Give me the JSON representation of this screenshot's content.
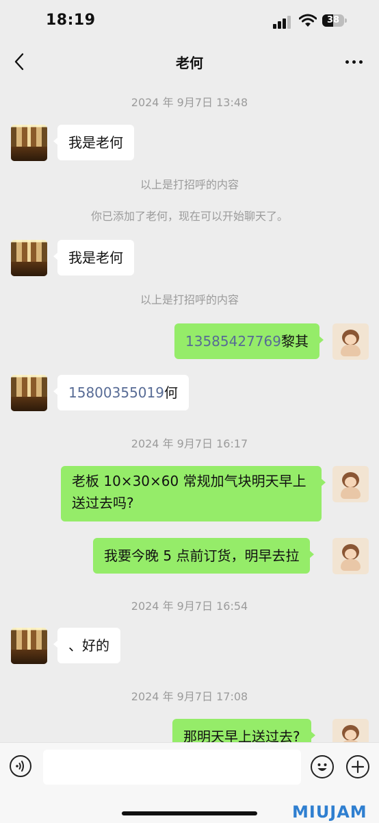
{
  "status": {
    "time": "18:19",
    "battery": "38",
    "icons": [
      "cellular-signal-icon",
      "wifi-icon",
      "battery-icon"
    ]
  },
  "nav": {
    "back_icon": "chevron-left-icon",
    "title": "老何",
    "more_icon": "more-horizontal-icon"
  },
  "messages": {
    "t1": "2024 年 9月7日 13:48",
    "m1": "我是老何",
    "sys1": "以上是打招呼的内容",
    "sys2": "你已添加了老何，现在可以开始聊天了。",
    "m2": "我是老何",
    "sys3": "以上是打招呼的内容",
    "m3_phone": "13585427769",
    "m3_name": "黎其",
    "m4_phone": "15800355019",
    "m4_name": "何",
    "t2": "2024 年 9月7日 16:17",
    "m5_line1": "老板 10×30×60 常规加气块明天早上",
    "m5_line2": "送过去吗?",
    "m6": "我要今晚 5 点前订货，明早去拉",
    "t3": "2024 年 9月7日 16:54",
    "m7": "、好的",
    "t4": "2024 年 9月7日 17:08",
    "m8": "那明天早上送过去?"
  },
  "input_bar": {
    "voice_icon": "voice-icon",
    "emoji_icon": "emoji-icon",
    "plus_icon": "plus-circle-icon",
    "text_value": ""
  },
  "watermark": "MIUJAM",
  "colors": {
    "background": "#ededed",
    "outgoing_bubble": "#95ec69",
    "incoming_bubble": "#ffffff",
    "link_phone": "#576b95",
    "meta_text": "#9b9b9b"
  }
}
